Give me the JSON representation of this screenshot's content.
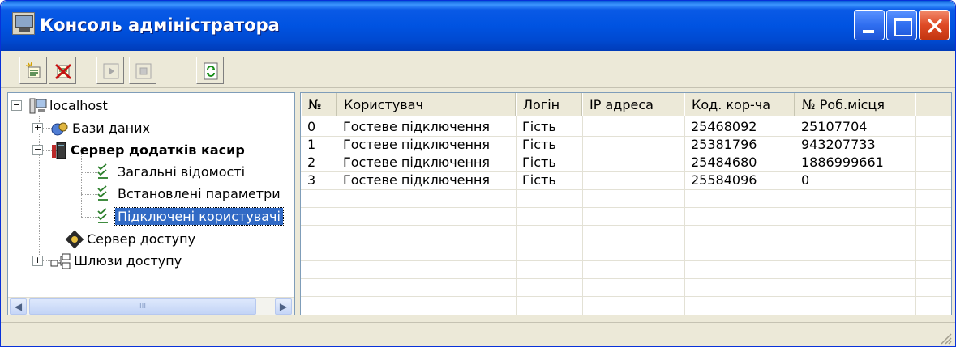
{
  "window": {
    "title": "Консоль адміністратора",
    "accent": "#0053e1"
  },
  "toolbar": {
    "buttons": [
      {
        "name": "add-connection",
        "icon": "add-icon"
      },
      {
        "name": "delete-connection",
        "icon": "delete-icon"
      },
      {
        "name": "play",
        "icon": "play-icon"
      },
      {
        "name": "stop",
        "icon": "stop-icon"
      },
      {
        "name": "refresh",
        "icon": "refresh-icon"
      }
    ]
  },
  "tree": {
    "root": "localhost",
    "items": [
      {
        "label": "Бази даних"
      },
      {
        "label": "Сервер додатків касир"
      },
      {
        "label": "Загальні відомості"
      },
      {
        "label": "Встановлені параметри"
      },
      {
        "label": "Підключені користувачі"
      },
      {
        "label": "Сервер доступу"
      },
      {
        "label": "Шлюзи доступу"
      }
    ],
    "scroll_thumb_marker": "III"
  },
  "grid": {
    "columns": [
      "№",
      "Користувач",
      "Логін",
      "IP адреса",
      "Код. кор-ча",
      "№ Роб.місця"
    ],
    "rows": [
      [
        "0",
        "Гостеве підключення",
        "Гість",
        "",
        "25468092",
        "25107704"
      ],
      [
        "1",
        "Гостеве підключення",
        "Гість",
        "",
        "25381796",
        "943207733"
      ],
      [
        "2",
        "Гостеве підключення",
        "Гість",
        "",
        "25484680",
        "1886999661"
      ],
      [
        "3",
        "Гостеве підключення",
        "Гість",
        "",
        "25584096",
        "0"
      ]
    ]
  }
}
